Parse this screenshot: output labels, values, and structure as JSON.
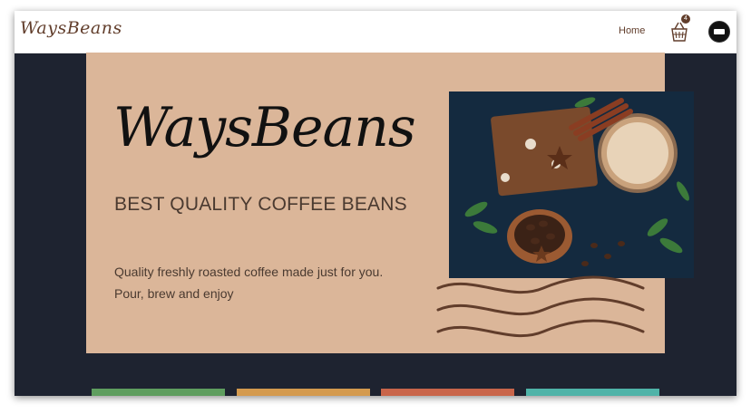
{
  "navbar": {
    "logo_text": "WaysBeans",
    "home_label": "Home",
    "cart_count": "4",
    "logo_icon": "waysbeans-logo",
    "cart_icon": "basket-icon",
    "avatar_icon": "user-avatar"
  },
  "hero": {
    "logo_text": "WaysBeans",
    "tagline": "BEST QUALITY COFFEE BEANS",
    "description_line1": "Quality freshly roasted coffee made just for you.",
    "description_line2": "Pour, brew and enjoy",
    "image": "coffee-and-beans-photo"
  },
  "colors": {
    "brand": "#613d2b",
    "hero_bg": "#dbb699",
    "page_bg": "#1e2330",
    "strips": [
      "#5f9e5f",
      "#d49a4e",
      "#c9654a",
      "#4fb3a8"
    ]
  }
}
